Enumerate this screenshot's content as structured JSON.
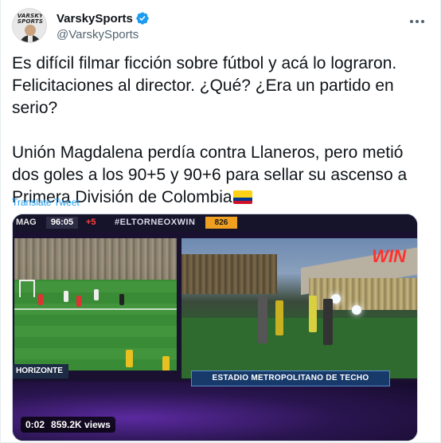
{
  "author": {
    "display_name": "VarskySports",
    "handle": "@VarskySports",
    "avatar_text": "VARSKY SPORTS",
    "verified": true
  },
  "tweet": {
    "paragraph_1": "Es difícil filmar ficción sobre fútbol y acá lo lograron. Felicitaciones al director. ¿Qué? ¿Era un partido en serio?",
    "paragraph_2": "Unión Magdalena perdía contra Llaneros, pero metió dos goles a los 90+5 y 90+6 para sellar su ascenso a Primera División de Colombia",
    "translate_label": "Translate Tweet"
  },
  "video": {
    "scoreboard_team": "MAG",
    "scoreboard_time": "96:05",
    "scoreboard_added": "+5",
    "scoreboard_hashtag": "#ELTORNEOXWIN",
    "scoreboard_number": "826",
    "caption_left": "HORIZONTE",
    "caption_right": "ESTADIO METROPOLITANO DE TECHO",
    "logo": "WIN",
    "elapsed": "0:02",
    "views": "859.2K views"
  },
  "colors": {
    "link_blue": "#1d9bf0",
    "verified_blue": "#1d9bf0",
    "text_primary": "#0f1419",
    "text_secondary": "#536471"
  },
  "icons": {
    "verified": "verified-badge-icon",
    "more": "more-horizontal-icon",
    "flag": "colombia-flag-icon"
  }
}
